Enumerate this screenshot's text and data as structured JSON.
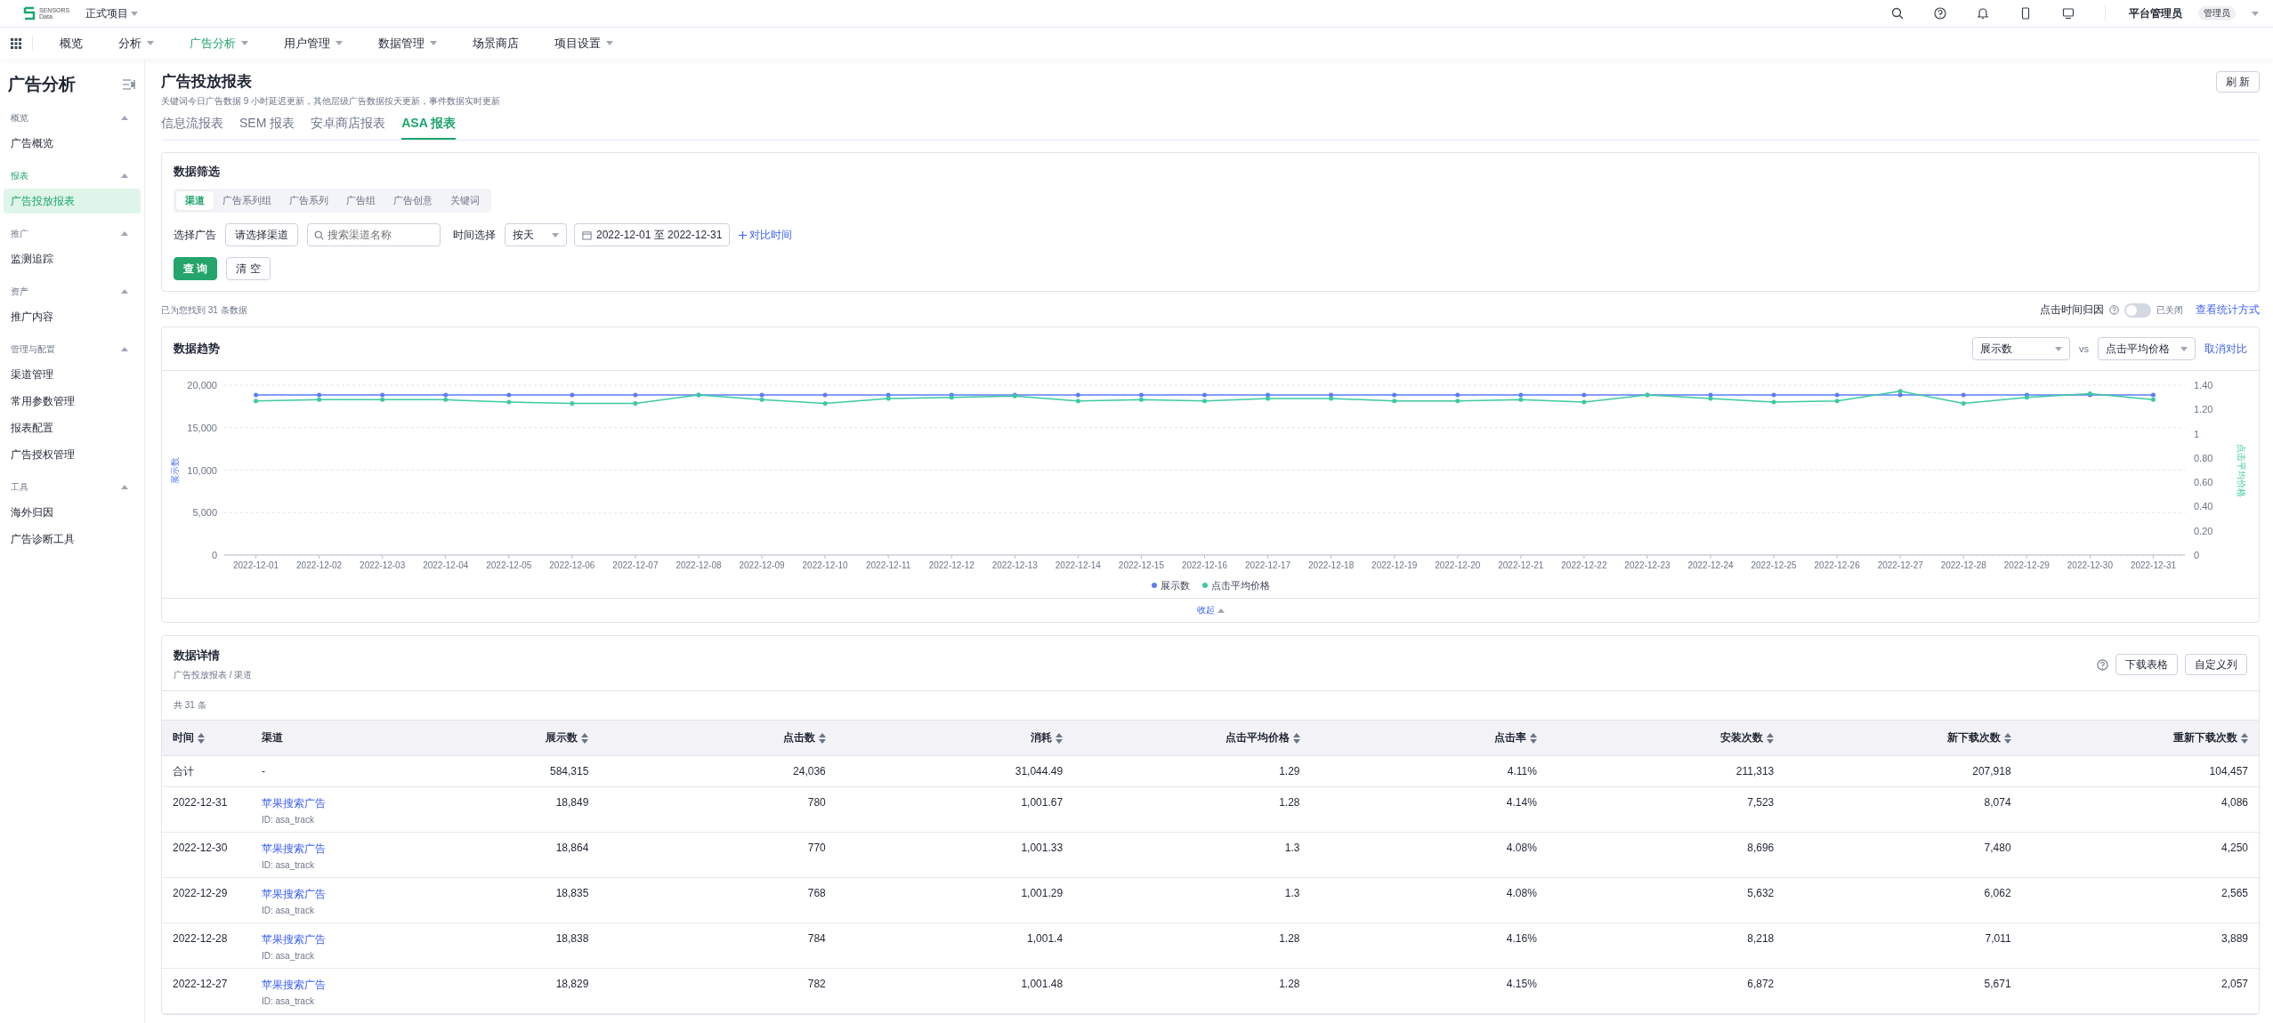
{
  "top_bar": {
    "logo_lines": [
      "SENSORS",
      "Data"
    ],
    "project": "正式项目",
    "user": "平台管理员",
    "role_badge": "管理员"
  },
  "nav": [
    {
      "label": "概览",
      "has_menu": false,
      "selected": false
    },
    {
      "label": "分析",
      "has_menu": true,
      "selected": false
    },
    {
      "label": "广告分析",
      "has_menu": true,
      "selected": true
    },
    {
      "label": "用户管理",
      "has_menu": true,
      "selected": false
    },
    {
      "label": "数据管理",
      "has_menu": true,
      "selected": false
    },
    {
      "label": "场景商店",
      "has_menu": false,
      "selected": false
    },
    {
      "label": "项目设置",
      "has_menu": true,
      "selected": false
    }
  ],
  "sidebar": {
    "title": "广告分析",
    "groups": [
      {
        "label": "概览",
        "expanded": true,
        "items": [
          {
            "label": "广告概览",
            "selected": false
          }
        ]
      },
      {
        "label": "报表",
        "expanded": true,
        "items": [
          {
            "label": "广告投放报表",
            "selected": true
          }
        ]
      },
      {
        "label": "推广",
        "expanded": true,
        "items": [
          {
            "label": "监测追踪",
            "selected": false
          }
        ]
      },
      {
        "label": "资产",
        "expanded": true,
        "items": [
          {
            "label": "推广内容",
            "selected": false
          }
        ]
      },
      {
        "label": "管理与配置",
        "expanded": true,
        "items": [
          {
            "label": "渠道管理",
            "selected": false
          },
          {
            "label": "常用参数管理",
            "selected": false
          },
          {
            "label": "报表配置",
            "selected": false
          },
          {
            "label": "广告授权管理",
            "selected": false
          }
        ]
      },
      {
        "label": "工具",
        "expanded": true,
        "items": [
          {
            "label": "海外归因",
            "selected": false
          },
          {
            "label": "广告诊断工具",
            "selected": false
          }
        ]
      }
    ]
  },
  "page": {
    "title": "广告投放报表",
    "subtitle": "关键词今日广告数据 9 小时延迟更新，其他层级广告数据按天更新，事件数据实时更新",
    "refresh_button": "刷 新",
    "tabs": [
      {
        "label": "信息流报表",
        "selected": false
      },
      {
        "label": "SEM 报表",
        "selected": false
      },
      {
        "label": "安卓商店报表",
        "selected": false
      },
      {
        "label": "ASA 报表",
        "selected": true
      }
    ]
  },
  "filter": {
    "title": "数据筛选",
    "dimension_tabs": [
      {
        "label": "渠道",
        "selected": true
      },
      {
        "label": "广告系列组",
        "selected": false
      },
      {
        "label": "广告系列",
        "selected": false
      },
      {
        "label": "广告组",
        "selected": false
      },
      {
        "label": "广告创意",
        "selected": false
      },
      {
        "label": "关键词",
        "selected": false
      }
    ],
    "ad_label": "选择广告",
    "channel_select": "请选择渠道",
    "search": {
      "placeholder": "搜索渠道名称"
    },
    "time_label": "时间选择",
    "granularity": "按天",
    "date_range": "2022-12-01 至 2022-12-31",
    "compare_link": "对比时间",
    "query_button": "查 询",
    "clear_button": "清 空"
  },
  "result_count": "已为您找到 31 条数据",
  "attribution": {
    "label": "点击时间归因",
    "on": false,
    "state_text": "已关闭",
    "link": "查看统计方式"
  },
  "trend": {
    "title": "数据趋势",
    "metric_a": "展示数",
    "vs": "vs",
    "metric_b": "点击平均价格",
    "cancel_link": "取消对比",
    "collapse": "收起",
    "chart_data": {
      "type": "line",
      "grid": true,
      "ylabel": "展示数",
      "y2label": "点击平均价格",
      "categories": [
        "2022-12-01",
        "2022-12-02",
        "2022-12-03",
        "2022-12-04",
        "2022-12-05",
        "2022-12-06",
        "2022-12-07",
        "2022-12-08",
        "2022-12-09",
        "2022-12-10",
        "2022-12-11",
        "2022-12-12",
        "2022-12-13",
        "2022-12-14",
        "2022-12-15",
        "2022-12-16",
        "2022-12-17",
        "2022-12-18",
        "2022-12-19",
        "2022-12-20",
        "2022-12-21",
        "2022-12-22",
        "2022-12-23",
        "2022-12-24",
        "2022-12-25",
        "2022-12-26",
        "2022-12-27",
        "2022-12-28",
        "2022-12-29",
        "2022-12-30",
        "2022-12-31"
      ],
      "ylim": [
        0,
        20000
      ],
      "y2lim": [
        0,
        1.4
      ],
      "yticks": [
        {
          "value": 0,
          "label": "0"
        },
        {
          "value": 5000,
          "label": "5,000"
        },
        {
          "value": 10000,
          "label": "10,000"
        },
        {
          "value": 15000,
          "label": "15,000"
        },
        {
          "value": 20000,
          "label": "20,000"
        }
      ],
      "y2ticks": [
        {
          "value": 0,
          "label": "0"
        },
        {
          "value": 0.2,
          "label": "0.20"
        },
        {
          "value": 0.4,
          "label": "0.40"
        },
        {
          "value": 0.6,
          "label": "0.60"
        },
        {
          "value": 0.8,
          "label": "0.80"
        },
        {
          "value": 1,
          "label": "1"
        },
        {
          "value": 1.2,
          "label": "1.20"
        },
        {
          "value": 1.4,
          "label": "1.40"
        }
      ],
      "series": [
        {
          "name": "展示数",
          "color": "#5b7cf7",
          "values": [
            18850,
            18850,
            18850,
            18850,
            18850,
            18850,
            18850,
            18850,
            18850,
            18850,
            18850,
            18850,
            18850,
            18850,
            18850,
            18850,
            18850,
            18850,
            18850,
            18850,
            18850,
            18850,
            18850,
            18850,
            18850,
            18850,
            18850,
            18850,
            18850,
            18850,
            18850
          ]
        },
        {
          "name": "点击平均价格",
          "color": "#3cc9a0",
          "axis": "y2",
          "values": [
            1.27,
            1.28,
            1.28,
            1.28,
            1.26,
            1.25,
            1.25,
            1.32,
            1.28,
            1.25,
            1.29,
            1.3,
            1.31,
            1.27,
            1.28,
            1.27,
            1.29,
            1.29,
            1.27,
            1.27,
            1.28,
            1.26,
            1.32,
            1.29,
            1.26,
            1.27,
            1.35,
            1.25,
            1.3,
            1.33,
            1.28
          ]
        }
      ]
    }
  },
  "details": {
    "title": "数据详情",
    "breadcrumb": "广告投放报表 / 渠道",
    "download_button": "下载表格",
    "columns_button": "自定义列",
    "total": "共 31 条",
    "columns": [
      {
        "label": "时间",
        "sortable": true
      },
      {
        "label": "渠道",
        "sortable": false
      },
      {
        "label": "展示数",
        "sortable": true
      },
      {
        "label": "点击数",
        "sortable": true
      },
      {
        "label": "消耗",
        "sortable": true
      },
      {
        "label": "点击平均价格",
        "sortable": true
      },
      {
        "label": "点击率",
        "sortable": true
      },
      {
        "label": "安装次数",
        "sortable": true
      },
      {
        "label": "新下载次数",
        "sortable": true
      },
      {
        "label": "重新下载次数",
        "sortable": true
      }
    ],
    "rows": [
      {
        "kind": "total",
        "time": "合计",
        "channel": "-",
        "values": [
          "584,315",
          "24,036",
          "31,044.49",
          "1.29",
          "4.11%",
          "211,313",
          "207,918",
          "104,457"
        ]
      },
      {
        "kind": "channel",
        "time": "2022-12-31",
        "channel": "苹果搜索广告",
        "channel_id": "ID: asa_track",
        "values": [
          "18,849",
          "780",
          "1,001.67",
          "1.28",
          "4.14%",
          "7,523",
          "8,074",
          "4,086"
        ]
      },
      {
        "kind": "channel",
        "time": "2022-12-30",
        "channel": "苹果搜索广告",
        "channel_id": "ID: asa_track",
        "values": [
          "18,864",
          "770",
          "1,001.33",
          "1.3",
          "4.08%",
          "8,696",
          "7,480",
          "4,250"
        ]
      },
      {
        "kind": "channel",
        "time": "2022-12-29",
        "channel": "苹果搜索广告",
        "channel_id": "ID: asa_track",
        "values": [
          "18,835",
          "768",
          "1,001.29",
          "1.3",
          "4.08%",
          "5,632",
          "6,062",
          "2,565"
        ]
      },
      {
        "kind": "channel",
        "time": "2022-12-28",
        "channel": "苹果搜索广告",
        "channel_id": "ID: asa_track",
        "values": [
          "18,838",
          "784",
          "1,001.4",
          "1.28",
          "4.16%",
          "8,218",
          "7,011",
          "3,889"
        ]
      },
      {
        "kind": "channel",
        "time": "2022-12-27",
        "channel": "苹果搜索广告",
        "channel_id": "ID: asa_track",
        "values": [
          "18,829",
          "782",
          "1,001.48",
          "1.28",
          "4.15%",
          "6,872",
          "5,671",
          "2,057"
        ]
      }
    ]
  }
}
